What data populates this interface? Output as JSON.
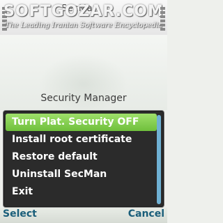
{
  "status": {
    "app_title_behind": "SecMan",
    "watermark_title": "SOFTGOZAR.COM",
    "watermark_subtitle": "The Leading Iranian Software Encyclopedia"
  },
  "dialog": {
    "title": "Security Manager",
    "items": [
      {
        "label": "Turn Plat. Security OFF",
        "selected": true
      },
      {
        "label": "Install root certificate",
        "selected": false
      },
      {
        "label": "Restore default",
        "selected": false
      },
      {
        "label": "Uninstall SecMan",
        "selected": false
      },
      {
        "label": "Exit",
        "selected": false
      }
    ]
  },
  "softkeys": {
    "left": "Select",
    "right": "Cancel"
  },
  "colors": {
    "selection": "#8fd45a",
    "softkey": "#1a5e7a",
    "scrollbar": "#6fb1d4",
    "dialog_bg": "#2b2b2b"
  }
}
